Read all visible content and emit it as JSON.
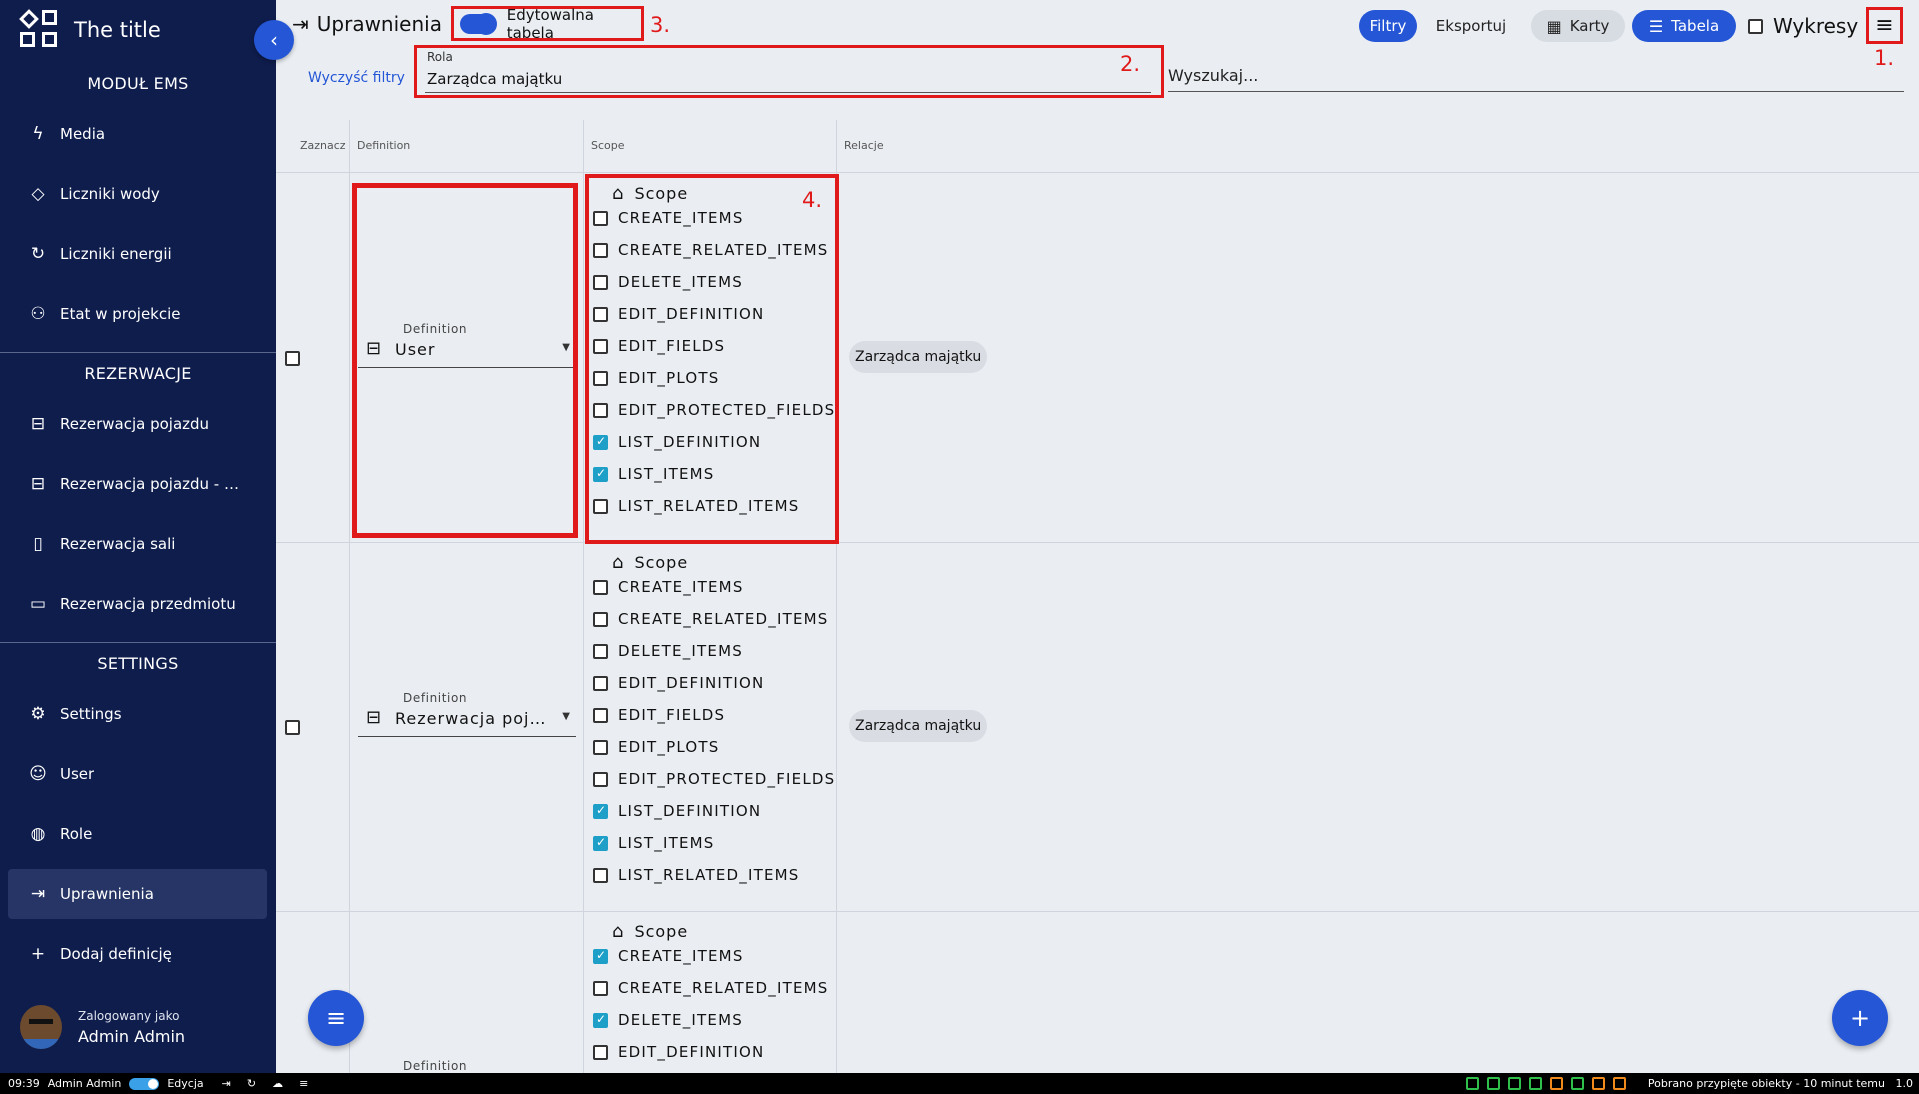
{
  "app": {
    "title": "The title"
  },
  "sidebar": {
    "sections": [
      {
        "title": "MODUŁ EMS",
        "items": [
          {
            "label": "Media",
            "icon": "bolt-icon"
          },
          {
            "label": "Liczniki wody",
            "icon": "water-drop-icon"
          },
          {
            "label": "Liczniki energii",
            "icon": "history-icon"
          },
          {
            "label": "Etat w projekcie",
            "icon": "people-icon"
          }
        ]
      },
      {
        "title": "REZERWACJE",
        "items": [
          {
            "label": "Rezerwacja pojazdu",
            "icon": "seat-icon"
          },
          {
            "label": "Rezerwacja pojazdu - wniosek",
            "icon": "seat-icon"
          },
          {
            "label": "Rezerwacja sali",
            "icon": "book-icon"
          },
          {
            "label": "Rezerwacja przedmiotu",
            "icon": "devices-icon"
          }
        ]
      },
      {
        "title": "SETTINGS",
        "items": [
          {
            "label": "Settings",
            "icon": "chip-icon"
          },
          {
            "label": "User",
            "icon": "face-icon"
          },
          {
            "label": "Role",
            "icon": "palette-icon"
          },
          {
            "label": "Uprawnienia",
            "icon": "login-icon",
            "active": true
          },
          {
            "label": "Dodaj definicję",
            "icon": "plus-icon"
          }
        ]
      }
    ],
    "user": {
      "logged_as": "Zalogowany jako",
      "name": "Admin Admin"
    }
  },
  "topbar": {
    "title": "Uprawnienia",
    "editable_table_label": "Edytowalna tabela",
    "editable_table_on": true,
    "filters_label": "Filtry",
    "export_label": "Eksportuj",
    "cards_label": "Karty",
    "table_label": "Tabela",
    "charts_label": "Wykresy",
    "annotations": [
      "1.",
      "2.",
      "3.",
      "4."
    ]
  },
  "filters": {
    "clear_label": "Wyczyść filtry",
    "role_label": "Rola",
    "role_value": "Zarządca majątku",
    "search_placeholder": "Wyszukaj..."
  },
  "table": {
    "headers": [
      "Zaznacz",
      "Definition",
      "Scope",
      "Relacje"
    ],
    "definition_label": "Definition",
    "scope_label": "Scope",
    "rows": [
      {
        "definition": "User",
        "relation": "Zarządca majątku",
        "scopes": [
          {
            "name": "CREATE_ITEMS",
            "checked": false
          },
          {
            "name": "CREATE_RELATED_ITEMS",
            "checked": false
          },
          {
            "name": "DELETE_ITEMS",
            "checked": false
          },
          {
            "name": "EDIT_DEFINITION",
            "checked": false
          },
          {
            "name": "EDIT_FIELDS",
            "checked": false
          },
          {
            "name": "EDIT_PLOTS",
            "checked": false
          },
          {
            "name": "EDIT_PROTECTED_FIELDS",
            "checked": false
          },
          {
            "name": "LIST_DEFINITION",
            "checked": true
          },
          {
            "name": "LIST_ITEMS",
            "checked": true
          },
          {
            "name": "LIST_RELATED_ITEMS",
            "checked": false
          }
        ]
      },
      {
        "definition": "Rezerwacja pojazdu",
        "relation": "Zarządca majątku",
        "scopes": [
          {
            "name": "CREATE_ITEMS",
            "checked": false
          },
          {
            "name": "CREATE_RELATED_ITEMS",
            "checked": false
          },
          {
            "name": "DELETE_ITEMS",
            "checked": false
          },
          {
            "name": "EDIT_DEFINITION",
            "checked": false
          },
          {
            "name": "EDIT_FIELDS",
            "checked": false
          },
          {
            "name": "EDIT_PLOTS",
            "checked": false
          },
          {
            "name": "EDIT_PROTECTED_FIELDS",
            "checked": false
          },
          {
            "name": "LIST_DEFINITION",
            "checked": true
          },
          {
            "name": "LIST_ITEMS",
            "checked": true
          },
          {
            "name": "LIST_RELATED_ITEMS",
            "checked": false
          }
        ]
      },
      {
        "definition": "",
        "relation": "",
        "scopes": [
          {
            "name": "CREATE_ITEMS",
            "checked": true
          },
          {
            "name": "CREATE_RELATED_ITEMS",
            "checked": false
          },
          {
            "name": "DELETE_ITEMS",
            "checked": true
          },
          {
            "name": "EDIT_DEFINITION",
            "checked": false
          }
        ]
      }
    ]
  },
  "statusbar": {
    "time": "09:39",
    "user": "Admin Admin",
    "mode": "Edycja",
    "message": "Pobrano przypięte obiekty - 10 minut temu",
    "version": "1.0"
  }
}
